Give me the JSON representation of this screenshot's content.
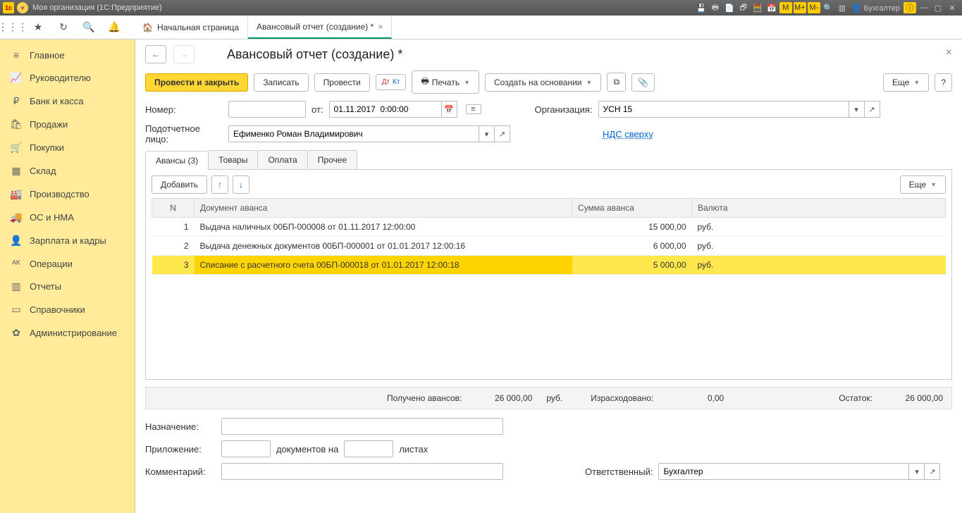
{
  "titlebar": {
    "title": "Моя организация  (1С:Предприятие)",
    "user": "Бухгалтер",
    "m_buttons": [
      "M",
      "M+",
      "M-"
    ]
  },
  "toolbar_tabs": {
    "home": "Начальная страница",
    "active": "Авансовый отчет (создание) *"
  },
  "sidebar": {
    "items": [
      {
        "label": "Главное",
        "icon": "≡"
      },
      {
        "label": "Руководителю",
        "icon": "📈"
      },
      {
        "label": "Банк и касса",
        "icon": "₽"
      },
      {
        "label": "Продажи",
        "icon": "🛍"
      },
      {
        "label": "Покупки",
        "icon": "🛒"
      },
      {
        "label": "Склад",
        "icon": "▦"
      },
      {
        "label": "Производство",
        "icon": "🏭"
      },
      {
        "label": "ОС и НМА",
        "icon": "🚚"
      },
      {
        "label": "Зарплата и кадры",
        "icon": "👤"
      },
      {
        "label": "Операции",
        "icon": "ᴬᴷ"
      },
      {
        "label": "Отчеты",
        "icon": "▥"
      },
      {
        "label": "Справочники",
        "icon": "▭"
      },
      {
        "label": "Администрирование",
        "icon": "✿"
      }
    ]
  },
  "page": {
    "title": "Авансовый отчет (создание) *",
    "buttons": {
      "process_close": "Провести и закрыть",
      "save": "Записать",
      "process": "Провести",
      "print": "Печать",
      "create_based": "Создать на основании",
      "more": "Еще",
      "help": "?"
    },
    "fields": {
      "number_label": "Номер:",
      "number_value": "",
      "from_label": "от:",
      "date_value": "01.11.2017  0:00:00",
      "org_label": "Организация:",
      "org_value": "УСН 15",
      "person_label": "Подотчетное лицо:",
      "person_value": "Ефименко Роман Владимирович",
      "nds_link": "НДС сверху"
    },
    "data_tabs": {
      "t0": "Авансы (3)",
      "t1": "Товары",
      "t2": "Оплата",
      "t3": "Прочее"
    },
    "table_actions": {
      "add": "Добавить",
      "more": "Еще"
    },
    "table": {
      "headers": {
        "n": "N",
        "doc": "Документ аванса",
        "sum": "Сумма аванса",
        "cur": "Валюта"
      },
      "rows": [
        {
          "n": "1",
          "doc": "Выдача наличных 00БП-000008 от 01.11.2017 12:00:00",
          "sum": "15 000,00",
          "cur": "руб."
        },
        {
          "n": "2",
          "doc": "Выдача денежных документов 00БП-000001 от 01.01.2017 12:00:16",
          "sum": "6 000,00",
          "cur": "руб."
        },
        {
          "n": "3",
          "doc": "Списание с расчетного счета 00БП-000018 от 01.01.2017 12:00:18",
          "sum": "5 000,00",
          "cur": "руб."
        }
      ]
    },
    "totals": {
      "received_label": "Получено авансов:",
      "received_value": "26 000,00",
      "received_cur": "руб.",
      "spent_label": "Израсходовано:",
      "spent_value": "0,00",
      "rest_label": "Остаток:",
      "rest_value": "26 000,00"
    },
    "footer": {
      "purpose_label": "Назначение:",
      "purpose_value": "",
      "attach_label": "Приложение:",
      "attach_docs": "документов на",
      "attach_sheets": "листах",
      "comment_label": "Комментарий:",
      "comment_value": "",
      "responsible_label": "Ответственный:",
      "responsible_value": "Бухгалтер"
    }
  }
}
